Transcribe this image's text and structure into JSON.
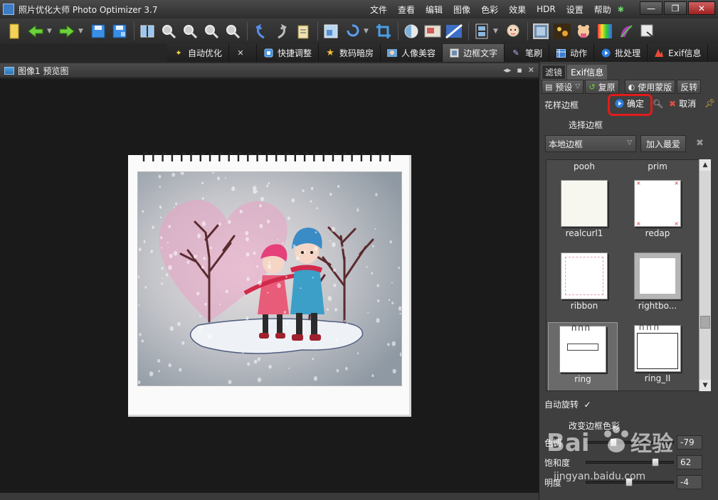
{
  "window": {
    "title": "照片优化大师 Photo Optimizer 3.7",
    "controls": [
      "—",
      "❐",
      "✕"
    ]
  },
  "menu": [
    "文件",
    "查看",
    "编辑",
    "图像",
    "色彩",
    "效果",
    "HDR",
    "设置",
    "帮助"
  ],
  "menu_badge": "✱",
  "toolbar_icons": [
    "open-file-icon",
    "back-icon",
    "forward-icon",
    "save-icon",
    "save-as-icon",
    "compare-icon",
    "zoom-in-icon",
    "zoom-out-icon",
    "zoom-fit-icon",
    "zoom-actual-icon",
    "undo-icon",
    "redo-icon",
    "clipboard-icon",
    "resize-icon",
    "rotate-icon",
    "crop-icon",
    "color-picker-icon",
    "effects-icon",
    "hdr-icon",
    "filmstrip-icon",
    "portrait-icon",
    "frame-icon",
    "sparkle-icon",
    "sticker-icon",
    "rainbow-icon",
    "brush-icon",
    "export-icon"
  ],
  "tabs": [
    {
      "label": "自动优化",
      "icon": "magic-wand-icon"
    },
    {
      "label": "",
      "icon": "tools-icon"
    },
    {
      "label": "快捷调整",
      "icon": "quick-adjust-icon"
    },
    {
      "label": "数码暗房",
      "icon": "star-icon"
    },
    {
      "label": "人像美容",
      "icon": "portrait-beauty-icon"
    },
    {
      "label": "边框文字",
      "icon": "frame-text-icon",
      "active": true
    },
    {
      "label": "笔刷",
      "icon": "brush-icon"
    },
    {
      "label": "动作",
      "icon": "actions-icon"
    },
    {
      "label": "批处理",
      "icon": "batch-icon"
    },
    {
      "label": "Exif信息",
      "icon": "exif-icon"
    }
  ],
  "preview": {
    "title": "图像1 预览图",
    "header_controls": [
      "◂▸",
      "▪",
      "✕"
    ]
  },
  "panel": {
    "tabs": [
      "滤镜",
      "Exif信息"
    ],
    "preset_label": "预设",
    "restore_label": "复原",
    "mask_label": "使用蒙版",
    "invert_label": "反转",
    "section_title": "花样边框",
    "confirm_label": "确定",
    "cancel_label": "取消",
    "select_frame_label": "选择边框",
    "frame_source": "本地边框",
    "add_favorite_label": "加入最爱",
    "gallery": [
      {
        "name": "pooh",
        "thumb": "none"
      },
      {
        "name": "prim",
        "thumb": "none"
      },
      {
        "name": "realcurl1",
        "thumb": "curl"
      },
      {
        "name": "redap",
        "thumb": "redap"
      },
      {
        "name": "ribbon",
        "thumb": "ribbon"
      },
      {
        "name": "rightbo...",
        "thumb": "rightborder"
      },
      {
        "name": "ring",
        "thumb": "ring",
        "selected": true
      },
      {
        "name": "ring_II",
        "thumb": "ring2"
      }
    ],
    "auto_rotate_label": "自动旋转",
    "auto_rotate_checked": "✓",
    "change_color_label": "改变边框色彩",
    "sliders": [
      {
        "label": "色调",
        "value": "-79",
        "level": 0.29
      },
      {
        "label": "饱和度",
        "value": "62",
        "level": 0.81
      },
      {
        "label": "明度",
        "value": "-4",
        "level": 0.48
      }
    ]
  },
  "watermark": {
    "brand": "Bai",
    "brand2": "经验",
    "url": "jingyan.baidu.com"
  },
  "colors": {
    "accent_red": "#e21b1b",
    "panel_bg": "#3f3f3f",
    "canvas_bg": "#1a1a1a"
  }
}
